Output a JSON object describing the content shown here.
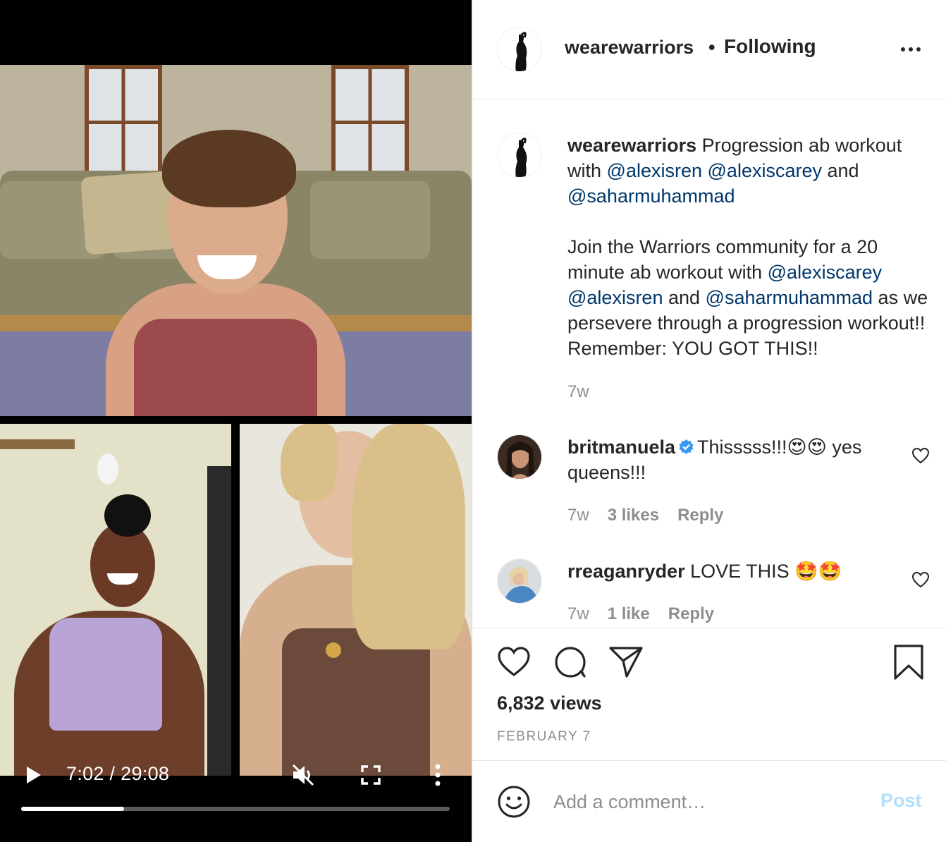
{
  "video": {
    "time_display": "7:02 / 29:08",
    "progress": 0.24,
    "muted": true
  },
  "post": {
    "username": "wearewarriors",
    "separator": "•",
    "follow_status": "Following",
    "more_label": "•••",
    "caption": {
      "username": "wearewarriors",
      "p1_text1": " Progression ab workout with ",
      "p1_m1": "@alexisren",
      "p1_m2": "@alexiscarey",
      "p1_text2": " and ",
      "p1_m3": "@saharmuhammad",
      "p2_text1": "Join the Warriors community for a 20 minute ab workout with ",
      "p2_m1": "@alexiscarey",
      "p2_m2": "@alexisren",
      "p2_text2": " and ",
      "p2_m3": "@saharmuhammad",
      "p2_text3": " as we persevere through a progression workout!! Remember: YOU GOT THIS!!",
      "age": "7w"
    },
    "comments": [
      {
        "username": "britmanuela",
        "verified": true,
        "text": "Thisssss!!!😍😍 yes queens!!!",
        "age": "7w",
        "likes": "3 likes",
        "reply": "Reply"
      },
      {
        "username": "rreaganryder",
        "verified": false,
        "text": "LOVE THIS 🤩🤩",
        "age": "7w",
        "likes": "1 like",
        "reply": "Reply"
      }
    ],
    "views": "6,832 views",
    "date": "FEBRUARY 7",
    "add_comment_placeholder": "Add a comment…",
    "post_button": "Post"
  },
  "colors": {
    "mention": "#00376b",
    "post_button_disabled": "#b2dffc",
    "verified": "#3897f0"
  },
  "icons": [
    "play-icon",
    "mute-icon",
    "fullscreen-icon",
    "more-vertical-icon",
    "more-horizontal-icon",
    "heart-icon",
    "comment-icon",
    "share-icon",
    "bookmark-icon",
    "emoji-icon",
    "verified-icon"
  ]
}
